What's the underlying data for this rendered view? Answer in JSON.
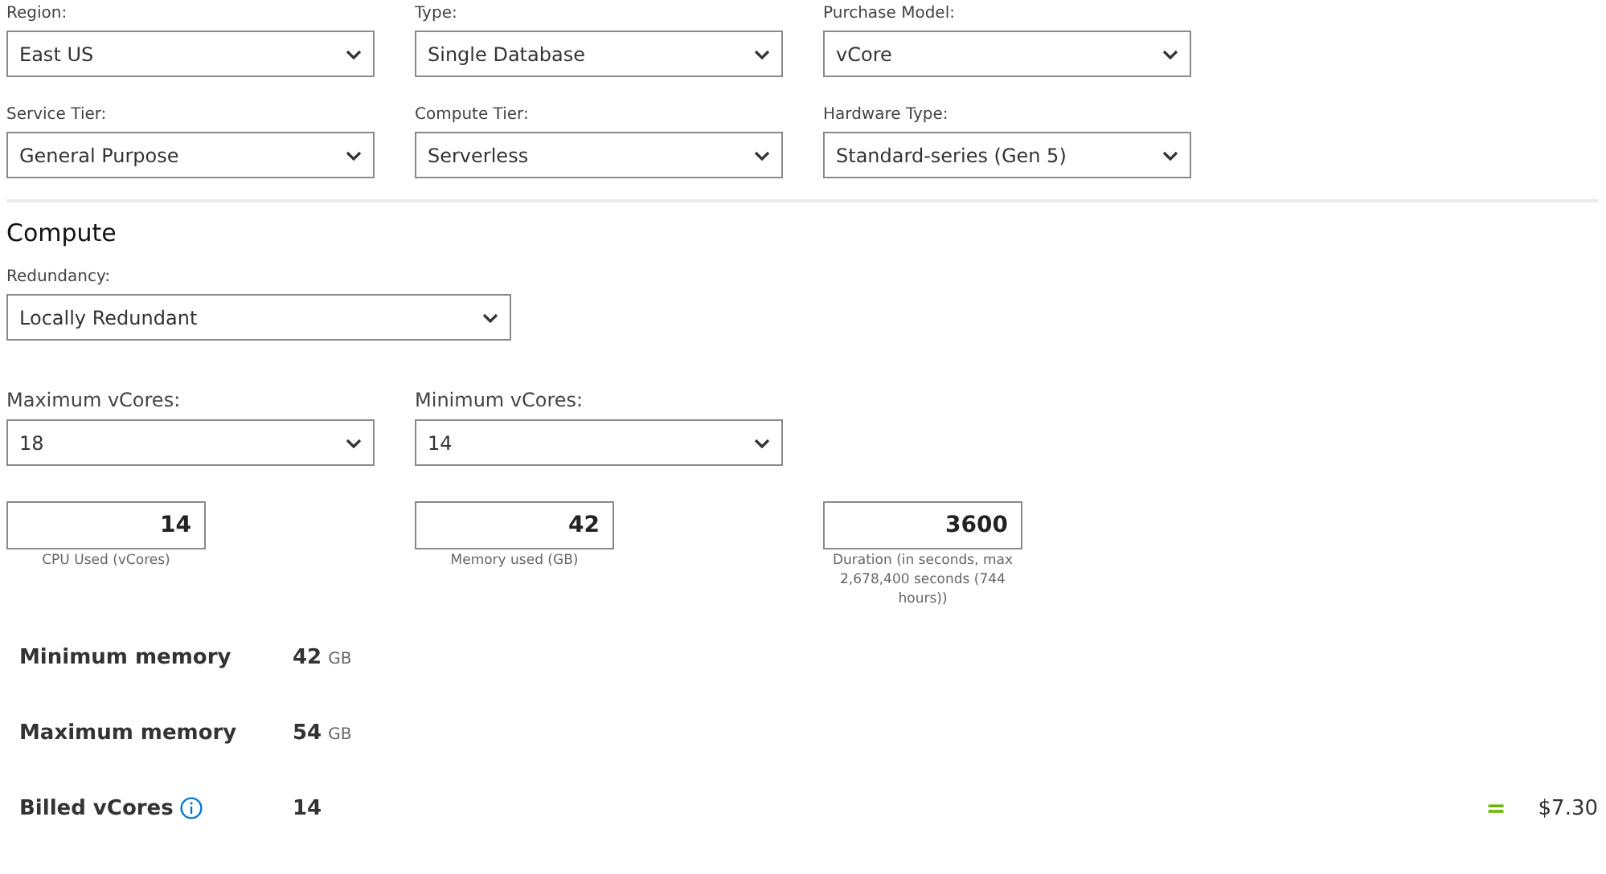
{
  "selects": [
    {
      "label": "Region:",
      "value": "East US"
    },
    {
      "label": "Type:",
      "value": "Single Database"
    },
    {
      "label": "Purchase Model:",
      "value": "vCore"
    },
    {
      "label": "Service Tier:",
      "value": "General Purpose"
    },
    {
      "label": "Compute Tier:",
      "value": "Serverless"
    },
    {
      "label": "Hardware Type:",
      "value": "Standard-series (Gen 5)"
    }
  ],
  "compute": {
    "heading": "Compute",
    "redundancy": {
      "label": "Redundancy:",
      "value": "Locally Redundant"
    },
    "vcores": [
      {
        "label": "Maximum vCores:",
        "value": "18"
      },
      {
        "label": "Minimum vCores:",
        "value": "14"
      }
    ],
    "inputs": [
      {
        "value": "14",
        "caption": "CPU Used (vCores)"
      },
      {
        "value": "42",
        "caption": "Memory used (GB)"
      },
      {
        "value": "3600",
        "caption": "Duration (in seconds, max 2,678,400 seconds (744 hours))"
      }
    ],
    "stats": [
      {
        "label": "Minimum memory",
        "value": "42",
        "unit": "GB",
        "info": false
      },
      {
        "label": "Maximum memory",
        "value": "54",
        "unit": "GB",
        "info": false
      },
      {
        "label": "Billed vCores",
        "value": "14",
        "info": true
      }
    ],
    "equals": "=",
    "total": "$7.30"
  }
}
